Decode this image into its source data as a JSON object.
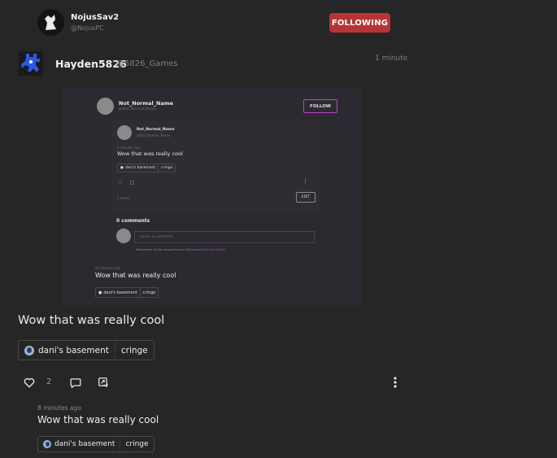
{
  "top_user": {
    "name": "NojusSav2",
    "handle": "@NojusPC"
  },
  "follow_button": {
    "label": "FOLLOWING",
    "color": "#b83434"
  },
  "post": {
    "author_name": "Hayden5826",
    "author_handle": "@5826_Games",
    "time": "1 minute",
    "body": "Wow that was really cool",
    "tags": [
      "dani's basement",
      "cringe"
    ],
    "like_count": "2",
    "icons": [
      "heart-icon",
      "comment-icon",
      "share-icon",
      "more-vertical-icon"
    ]
  },
  "screenshot": {
    "user_name": "Not_Normal_Name",
    "user_handle": "@Not_Normal_Name",
    "follow_label": "FOLLOW",
    "inner_user_name": "Not_Normal_Name",
    "inner_user_handle": "@Not_Normal_Name",
    "inner_time": "2 minutes ago",
    "inner_body": "Wow that was really cool",
    "inner_tags": [
      "dani's basement",
      "cringe"
    ],
    "views": "1 views",
    "edit_label": "EDIT",
    "comments_heading": "0 comments",
    "comment_placeholder": "Leave a comment",
    "reminder_text": "Remember to be respectful and follow our",
    "guidelines_link": "Site Guidelines",
    "quoted_time": "22 minutes ago",
    "quoted_body": "Wow that was really cool",
    "quoted_tags": [
      "dani's basement",
      "cringe"
    ]
  },
  "quoted": {
    "time": "8 minutes ago",
    "body": "Wow that was really cool",
    "tags": [
      "dani's basement",
      "cringe"
    ]
  }
}
